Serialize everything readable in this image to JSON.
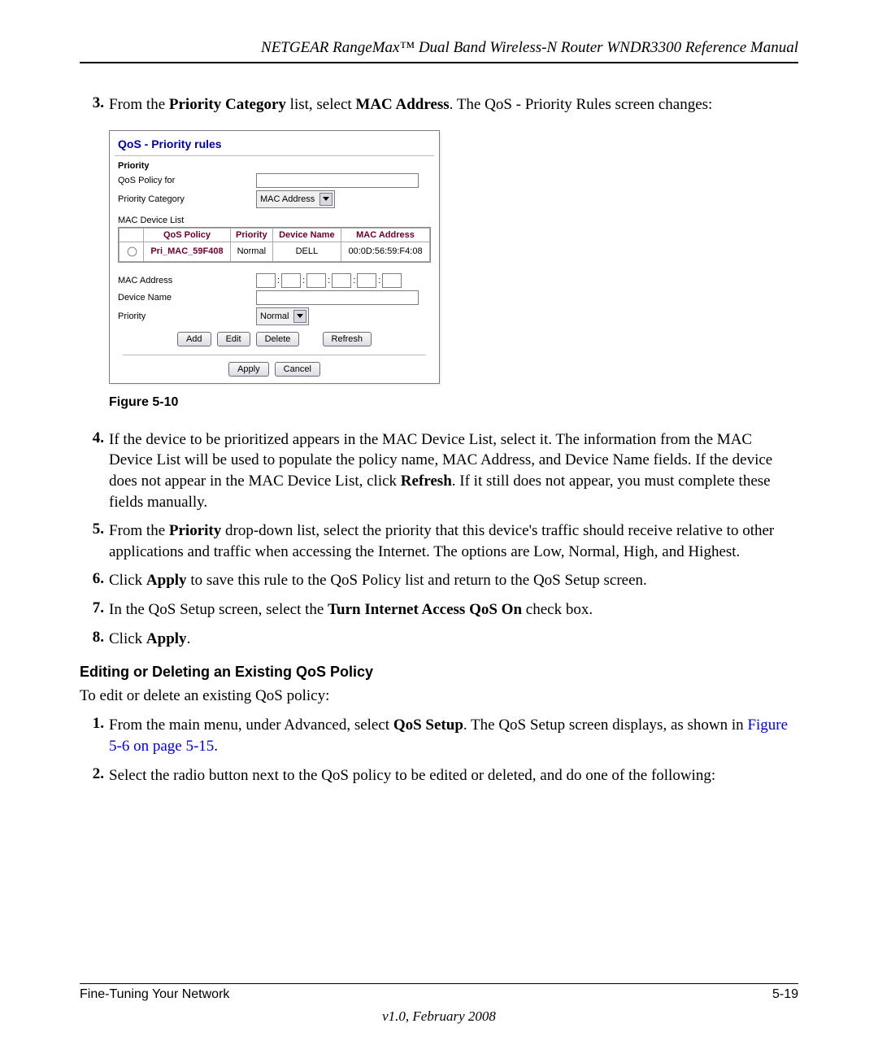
{
  "header": {
    "running_title": "NETGEAR RangeMax™ Dual Band Wireless-N Router WNDR3300 Reference Manual"
  },
  "step3": {
    "num": "3.",
    "t1": "From the ",
    "b1": "Priority Category",
    "t2": " list, select ",
    "b2": "MAC Address",
    "t3": ". The QoS - Priority Rules screen changes:"
  },
  "shot": {
    "title": "QoS - Priority rules",
    "priority_label_b": "Priority",
    "qos_for_label": "QoS Policy for",
    "priority_cat_label": "Priority Category",
    "priority_cat_value": "MAC Address",
    "mac_device_list_label": "MAC Device List",
    "table": {
      "h_sel": "",
      "h_policy": "QoS Policy",
      "h_priority": "Priority",
      "h_devname": "Device Name",
      "h_mac": "MAC Address",
      "rows": [
        {
          "policy": "Pri_MAC_59F408",
          "priority": "Normal",
          "devname": "DELL",
          "mac": "00:0D:56:59:F4:08"
        }
      ]
    },
    "mac_address_label": "MAC Address",
    "device_name_label": "Device Name",
    "priority_label2": "Priority",
    "priority_value2": "Normal",
    "btn_add": "Add",
    "btn_edit": "Edit",
    "btn_delete": "Delete",
    "btn_refresh": "Refresh",
    "btn_apply": "Apply",
    "btn_cancel": "Cancel"
  },
  "fig_cap": "Figure 5-10",
  "step4": {
    "num": "4.",
    "t1": "If the device to be prioritized appears in the MAC Device List, select it. The information from the MAC Device List will be used to populate the policy name, MAC Address, and Device Name fields. If the device does not appear in the MAC Device List, click ",
    "b1": "Refresh",
    "t2": ". If it still does not appear, you must complete these fields manually."
  },
  "step5": {
    "num": "5.",
    "t1": "From the ",
    "b1": "Priority",
    "t2": " drop-down list, select the priority that this device's traffic should receive relative to other applications and traffic when accessing the Internet. The options are Low, Normal, High, and Highest."
  },
  "step6": {
    "num": "6.",
    "t1": "Click ",
    "b1": "Apply",
    "t2": " to save this rule to the QoS Policy list and return to the QoS Setup screen."
  },
  "step7": {
    "num": "7.",
    "t1": "In the QoS Setup screen, select the ",
    "b1": "Turn Internet Access QoS On",
    "t2": " check box."
  },
  "step8": {
    "num": "8.",
    "t1": "Click ",
    "b1": "Apply",
    "t2": "."
  },
  "editing": {
    "heading": "Editing or Deleting an Existing QoS Policy",
    "intro": "To edit or delete an existing QoS policy:",
    "s1": {
      "num": "1.",
      "t1": "From the main menu, under Advanced, select ",
      "b1": "QoS Setup",
      "t2": ". The QoS Setup screen displays, as shown in ",
      "link": "Figure 5-6 on page 5-15",
      "t3": "."
    },
    "s2": {
      "num": "2.",
      "t1": "Select the radio button next to the QoS policy to be edited or deleted, and do one of the following:"
    }
  },
  "footer": {
    "left": "Fine-Tuning Your Network",
    "right": "5-19",
    "version": "v1.0, February 2008"
  }
}
